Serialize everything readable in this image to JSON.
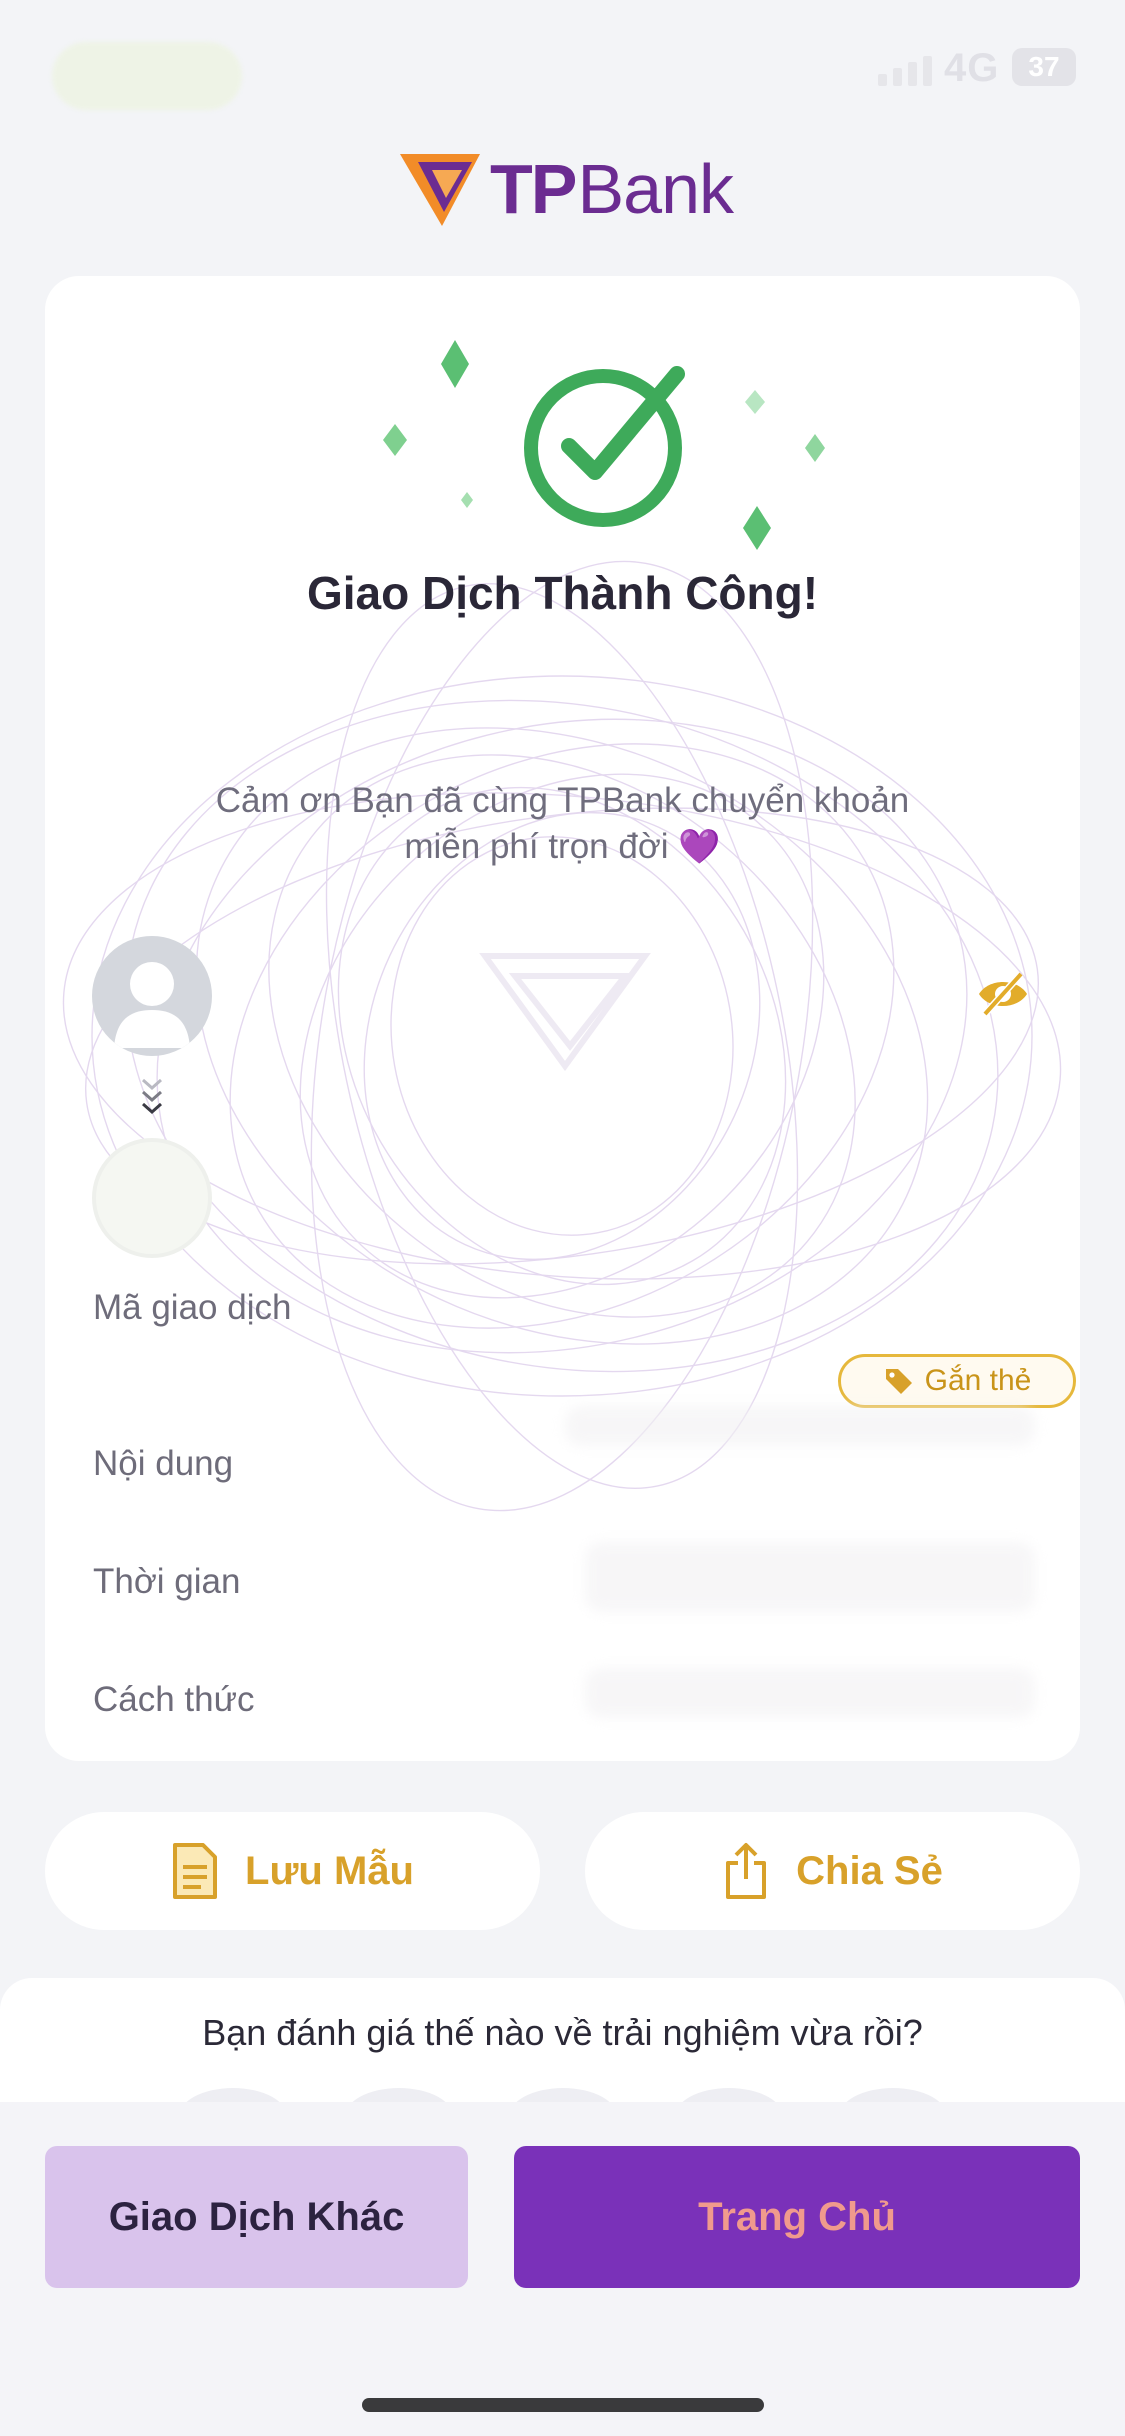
{
  "status_bar": {
    "network": "4G",
    "battery": "37"
  },
  "brand": {
    "name_bold": "TP",
    "name_regular": "Bank",
    "colors": {
      "purple": "#6b2c91",
      "orange": "#f28c28",
      "gold": "#d8a12a",
      "green": "#3eaa5a"
    }
  },
  "receipt": {
    "title": "Giao Dịch Thành Công!",
    "thanks_line1": "Cảm ơn Bạn đã cùng TPBank chuyển khoản",
    "thanks_line2": "miễn phí trọn đời",
    "thanks_emoji": "💜",
    "icons": {
      "success": "check-circle-icon",
      "hide_balance": "eye-off-icon",
      "tag": "tag-icon"
    },
    "fields": [
      {
        "label": "Mã giao dịch"
      },
      {
        "label": "Nội dung"
      },
      {
        "label": "Thời gian"
      },
      {
        "label": "Cách thức"
      }
    ],
    "tag_label": "Gắn thẻ"
  },
  "actions": {
    "save_template": "Lưu Mẫu",
    "share": "Chia Sẻ"
  },
  "rating": {
    "question": "Bạn đánh giá thế nào về trải nghiệm vừa rồi?"
  },
  "footer": {
    "other_transaction": "Giao Dịch Khác",
    "home": "Trang Chủ"
  }
}
